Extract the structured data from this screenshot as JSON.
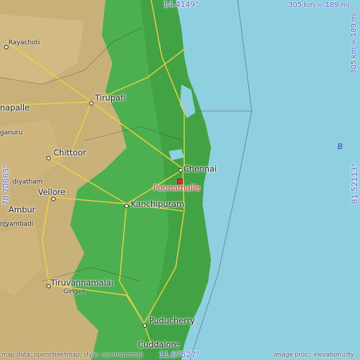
{
  "map": {
    "coords": {
      "top": "14.4149°",
      "bottom": "11.67527°",
      "left": "78.70863°",
      "right": "81.52113°"
    },
    "scale": {
      "horizontal": "305 km = 189 mi",
      "vertical": "305 km = 189 mi"
    },
    "highlight": "Poonamalle",
    "sea_label": "B",
    "cities": {
      "chennai": "Chennai",
      "tirupati": "Tirupati",
      "chittoor": "Chittoor",
      "vellore": "Vellore",
      "kanchipuram": "Kanchipuram",
      "tiruvannamalai": "Tiruvannamalai",
      "puducherry": "Puducherry",
      "cuddalore": "Cuddalore",
      "ambur": "Ambur",
      "rayachoti": "Rayachoti",
      "napalle": "napalle",
      "ganuru": "ganuru",
      "diyatham": "diyatham",
      "niyambadi": "niyambadi",
      "gingee": "Gingee"
    },
    "attribution": {
      "left": "map data: openstreetmap, style: opentopomap",
      "right": "image proc.: elevation.city"
    },
    "colors": {
      "sea": "#8fd0e0",
      "lowland": "#4caf50",
      "upland": "#c9b27a",
      "marker": "#e0283c",
      "coord_text": "#5b5fd2"
    }
  }
}
